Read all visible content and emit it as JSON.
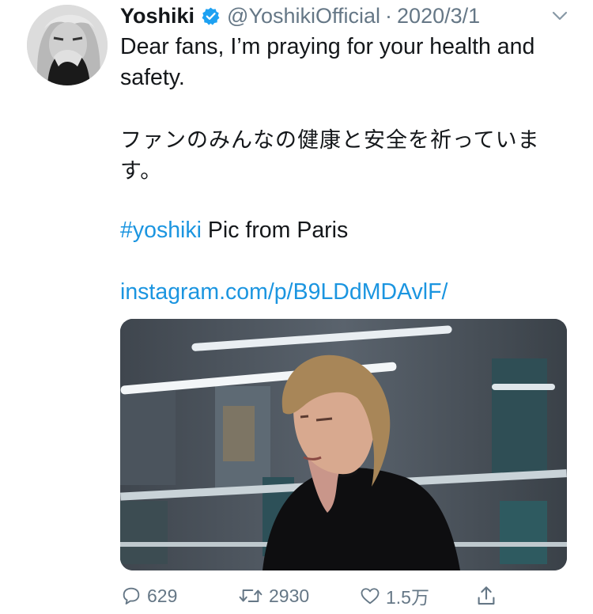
{
  "tweet": {
    "author": {
      "name": "Yoshiki",
      "handle": "@YoshikiOfficial",
      "verified": true,
      "avatar": "avatar-photo"
    },
    "separator": "·",
    "date": "2020/3/1",
    "text": {
      "english": "Dear fans, I’m praying for your health and safety.",
      "japanese": "ファンのみんなの健康と安全を祈っています。",
      "hashtag": "#yoshiki",
      "hashtag_suffix": " Pic from Paris",
      "link": "instagram.com/p/B9LDdMDAvlF/"
    },
    "media": {
      "type": "photo",
      "description_icon": "photo-man-in-black-coat"
    },
    "actions": {
      "replies": "629",
      "retweets": "2930",
      "likes": "1.5万"
    }
  },
  "colors": {
    "text": "#14171a",
    "muted": "#657786",
    "link": "#1b95e0",
    "verified": "#1da1f2"
  },
  "icons": {
    "verified": "verified-badge-icon",
    "menu": "chevron-down-icon",
    "reply": "reply-icon",
    "retweet": "retweet-icon",
    "like": "heart-icon",
    "share": "share-icon"
  }
}
